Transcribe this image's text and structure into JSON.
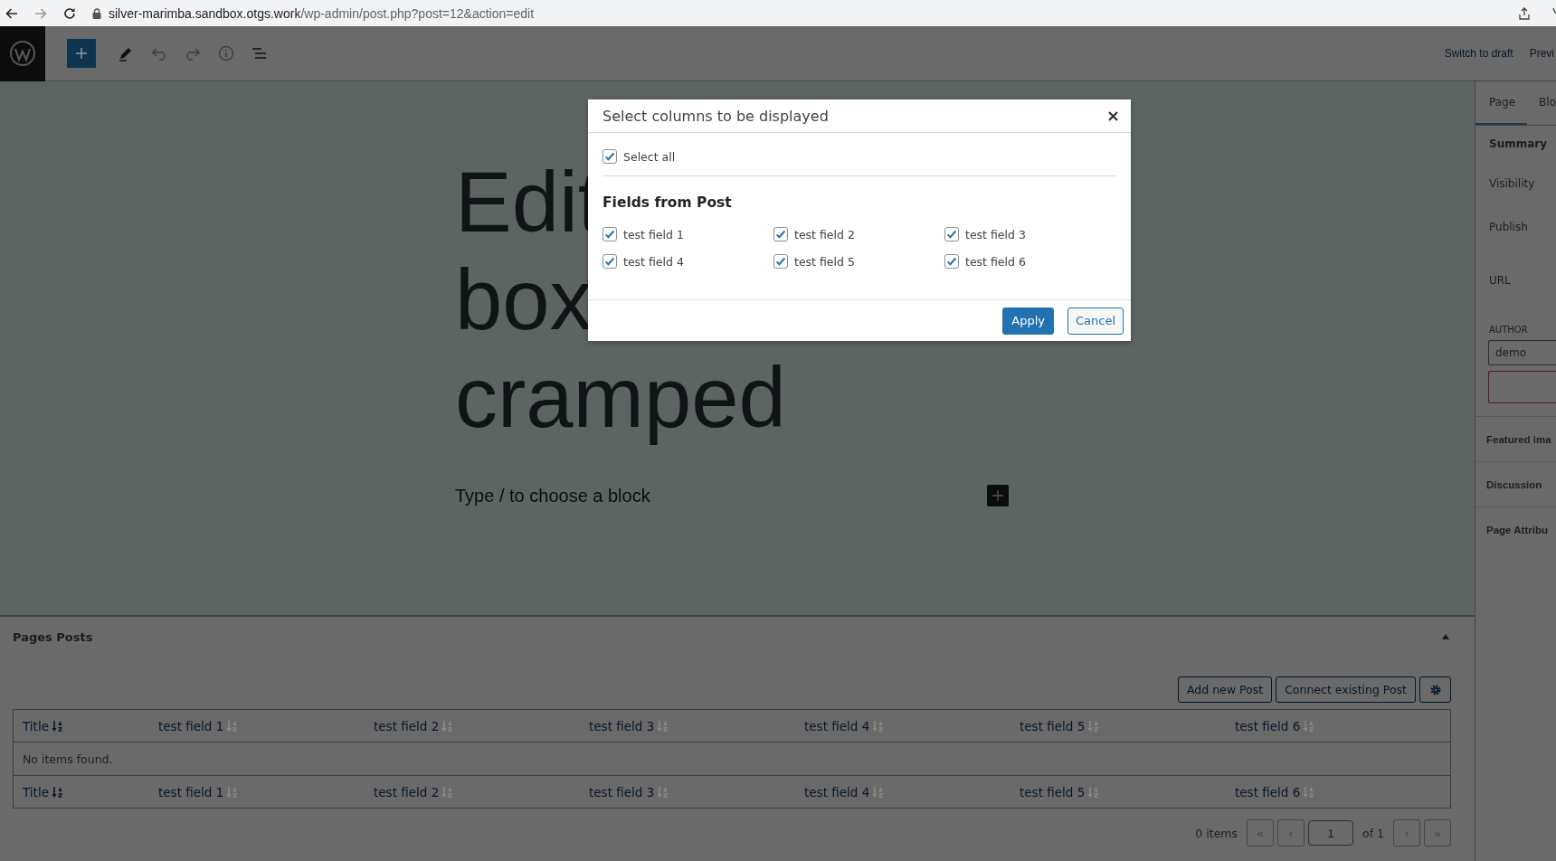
{
  "browser": {
    "host": "silver-marimba.sandbox.otgs.work",
    "path": "/wp-admin/post.php?post=12&action=edit"
  },
  "toolbar": {
    "links": [
      "Switch to draft",
      "Previ"
    ]
  },
  "editor": {
    "title_lines": [
      "Edit",
      "box",
      "cramped"
    ],
    "placeholder": "Type / to choose a block"
  },
  "sidebar": {
    "tabs": [
      {
        "label": "Page",
        "selected": true
      },
      {
        "label": "Blo",
        "selected": false
      }
    ],
    "rows": [
      {
        "kind": "label",
        "text": "Summary"
      },
      {
        "kind": "row",
        "text": "Visibility"
      },
      {
        "kind": "row",
        "text": "Publish"
      },
      {
        "kind": "row",
        "text": "URL"
      },
      {
        "kind": "heading",
        "text": "AUTHOR"
      },
      {
        "kind": "field",
        "text": "demo"
      },
      {
        "kind": "error-field",
        "text": ""
      },
      {
        "kind": "section",
        "text": "Featured ima"
      },
      {
        "kind": "section",
        "text": "Discussion"
      },
      {
        "kind": "section",
        "text": "Page Attribu"
      }
    ]
  },
  "modal": {
    "title": "Select columns to be displayed",
    "select_all": {
      "label": "Select all",
      "checked": true
    },
    "section_title": "Fields from Post",
    "fields": [
      {
        "label": "test field 1",
        "checked": true
      },
      {
        "label": "test field 2",
        "checked": true
      },
      {
        "label": "test field 3",
        "checked": true
      },
      {
        "label": "test field 4",
        "checked": true
      },
      {
        "label": "test field 5",
        "checked": true
      },
      {
        "label": "test field 6",
        "checked": true
      }
    ],
    "apply": "Apply",
    "cancel": "Cancel"
  },
  "panel": {
    "title": "Pages Posts",
    "buttons": [
      "Add new Post",
      "Connect existing Post"
    ],
    "header_columns": [
      {
        "label": "Title",
        "sort_active": true
      },
      {
        "label": "test field 1",
        "sort_active": false
      },
      {
        "label": "test field 2",
        "sort_active": false
      },
      {
        "label": "test field 3",
        "sort_active": false
      },
      {
        "label": "test field 4",
        "sort_active": false
      },
      {
        "label": "test field 5",
        "sort_active": false
      },
      {
        "label": "test field 6",
        "sort_active": false
      }
    ],
    "empty_message": "No items found.",
    "footer_columns": [
      {
        "label": "Title",
        "sort_active": true
      },
      {
        "label": "test field 1",
        "sort_active": false
      },
      {
        "label": "test field 2",
        "sort_active": false
      },
      {
        "label": "test field 3",
        "sort_active": false
      },
      {
        "label": "test field 4",
        "sort_active": false
      },
      {
        "label": "test field 5",
        "sort_active": false
      },
      {
        "label": "test field 6",
        "sort_active": false
      }
    ],
    "pagination": {
      "count": "0 items",
      "first": "«",
      "prev": "‹",
      "page": "1",
      "of": "of 1",
      "next": "›",
      "last": "»"
    }
  }
}
